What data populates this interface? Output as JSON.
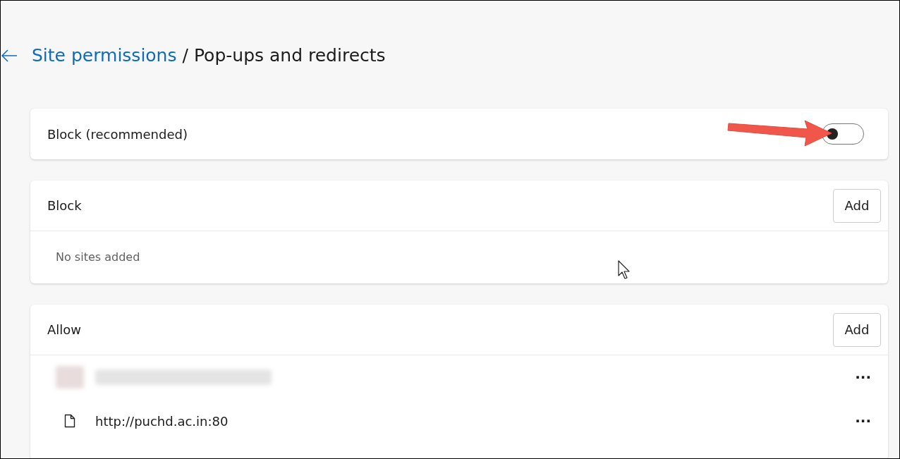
{
  "breadcrumb": {
    "parent": "Site permissions",
    "separator": "/",
    "current": "Pop-ups and redirects"
  },
  "block_toggle": {
    "label": "Block (recommended)",
    "on": false
  },
  "block_list": {
    "title": "Block",
    "add_button": "Add",
    "empty_text": "No sites added"
  },
  "allow_list": {
    "title": "Allow",
    "add_button": "Add",
    "sites": [
      {
        "kind": "blurred",
        "more": "···"
      },
      {
        "kind": "file",
        "url": "http://puchd.ac.in:80",
        "more": "···"
      }
    ]
  }
}
